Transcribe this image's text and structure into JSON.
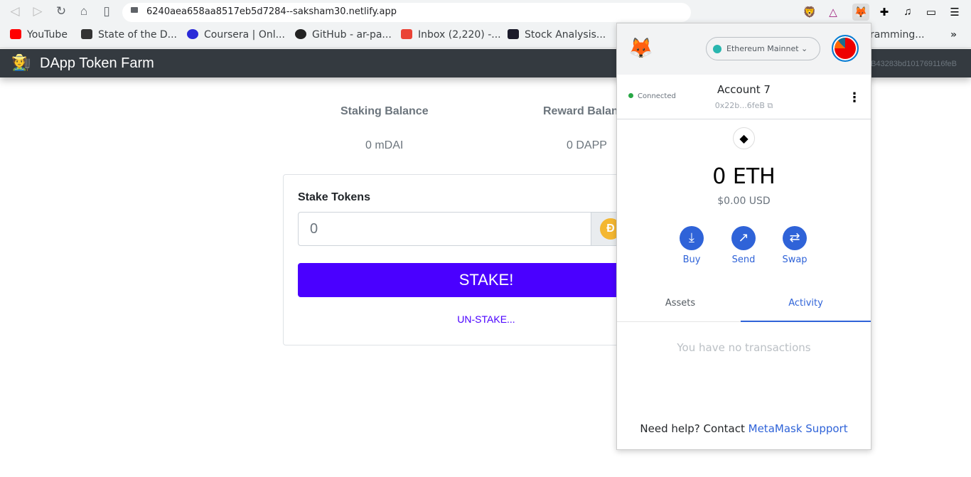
{
  "browser": {
    "url": "6240aea658aa8517eb5d7284--saksham30.netlify.app",
    "bookmarks": [
      {
        "label": "YouTube",
        "color": "#ff0000"
      },
      {
        "label": "State of the D...",
        "color": "#333333"
      },
      {
        "label": "Coursera | Onl...",
        "color": "#2a2ad8"
      },
      {
        "label": "GitHub - ar-pa...",
        "color": "#222222"
      },
      {
        "label": "Inbox (2,220) -...",
        "color": "#ea4335"
      },
      {
        "label": "Stock Analysis...",
        "color": "#1b1b2a"
      },
      {
        "label": "ramming...",
        "color": "#5a3ec8"
      }
    ],
    "more": "»"
  },
  "app": {
    "brand": "DApp Token Farm",
    "account": "E0B43283bd101769116feB"
  },
  "balances": {
    "staking_label": "Staking Balance",
    "staking_value": "0 mDAI",
    "reward_label": "Reward Balan",
    "reward_value": "0 DAPP"
  },
  "stake": {
    "title": "Stake Tokens",
    "input_value": "0",
    "stake_button": "STAKE!",
    "unstake_link": "UN-STAKE..."
  },
  "metamask": {
    "network": "Ethereum Mainnet",
    "status": "Connected",
    "account_name": "Account 7",
    "address": "0x22b...6feB",
    "balance": "0 ETH",
    "usd": "$0.00 USD",
    "actions": [
      {
        "label": "Buy",
        "icon": "download-icon"
      },
      {
        "label": "Send",
        "icon": "arrow-up-right-icon"
      },
      {
        "label": "Swap",
        "icon": "swap-icon"
      }
    ],
    "tabs": [
      "Assets",
      "Activity"
    ],
    "active_tab": "Activity",
    "empty": "You have no transactions",
    "help_text": "Need help? Contact ",
    "help_link": "MetaMask Support"
  }
}
